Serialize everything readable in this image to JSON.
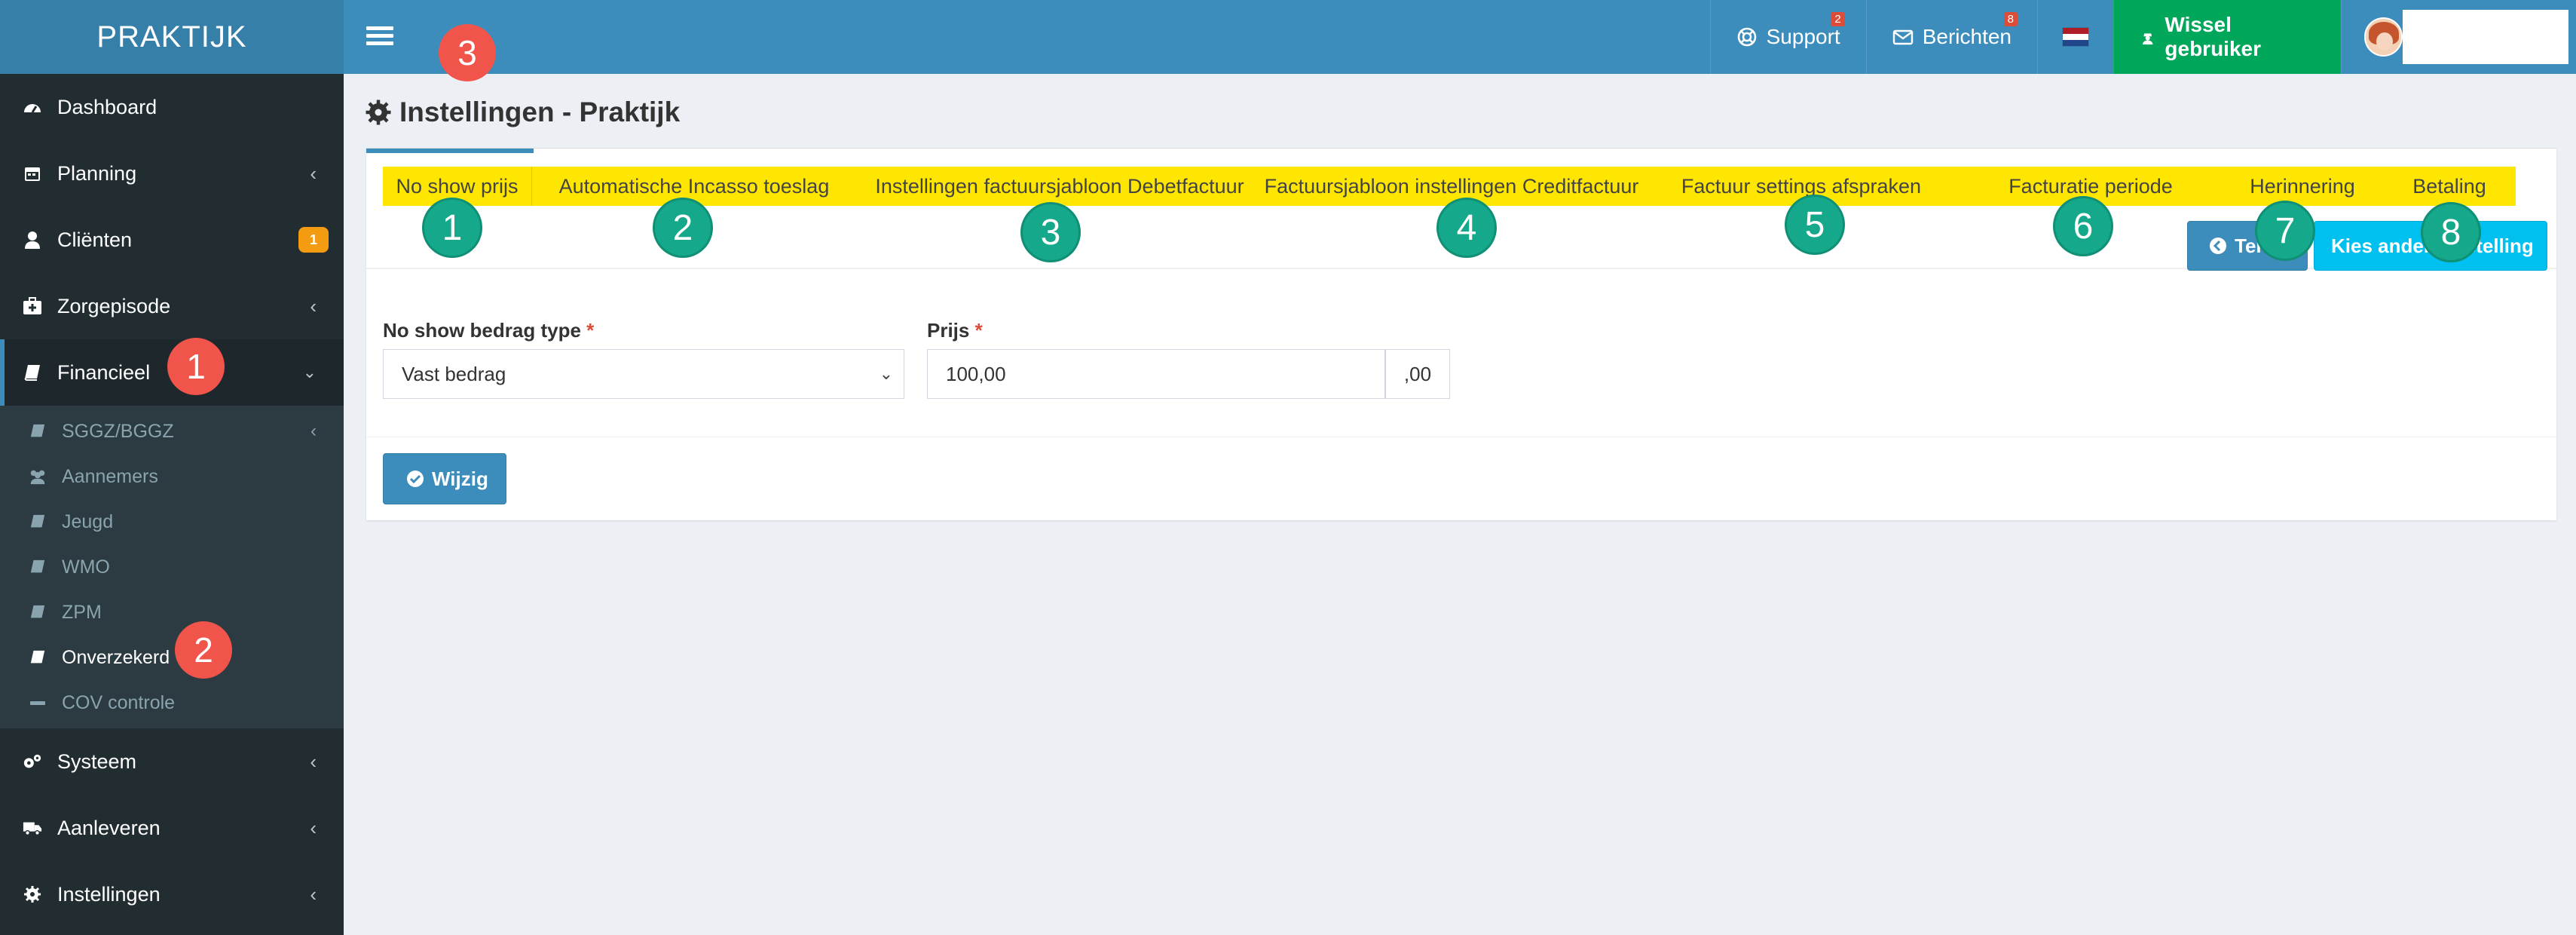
{
  "header": {
    "logo_text": "PRAKTIJK",
    "support_label": "Support",
    "support_badge": "2",
    "berichten_label": "Berichten",
    "berichten_badge": "8",
    "wissel_label": "Wissel gebruiker",
    "colors": {
      "topbar": "#3c8dbc",
      "logo_bg": "#367fa9",
      "wissel_bg": "#00a65a"
    }
  },
  "sidebar": {
    "items": [
      {
        "label": "Dashboard"
      },
      {
        "label": "Planning"
      },
      {
        "label": "Cliënten",
        "badge": "1"
      },
      {
        "label": "Zorgepisode"
      },
      {
        "label": "Financieel"
      },
      {
        "label": "Systeem"
      },
      {
        "label": "Aanleveren"
      },
      {
        "label": "Instellingen"
      }
    ],
    "submenu": [
      {
        "label": "SGGZ/BGGZ"
      },
      {
        "label": "Aannemers"
      },
      {
        "label": "Jeugd"
      },
      {
        "label": "WMO"
      },
      {
        "label": "ZPM"
      },
      {
        "label": "Onverzekerd"
      },
      {
        "label": "COV controle"
      }
    ]
  },
  "markers": {
    "red": [
      "1",
      "2",
      "3"
    ],
    "green": [
      "1",
      "2",
      "3",
      "4",
      "5",
      "6",
      "7",
      "8"
    ]
  },
  "page": {
    "title": "Instellingen - Praktijk"
  },
  "tabs": [
    "No show prijs",
    "Automatische Incasso toeslag",
    "Instellingen factuursjabloon Debetfactuur",
    "Factuursjabloon instellingen Creditfactuur",
    "Factuur settings afspraken",
    "Facturatie periode",
    "Herinnering",
    "Betaling"
  ],
  "buttons": {
    "terug": "Terug",
    "kies": "Kies andere instelling",
    "wijzig": "Wijzig"
  },
  "form": {
    "bedrag_type_label": "No show bedrag type",
    "bedrag_type_value": "Vast bedrag",
    "prijs_label": "Prijs",
    "prijs_value": "100,00",
    "prijs_addon": ",00",
    "required_mark": "*"
  }
}
